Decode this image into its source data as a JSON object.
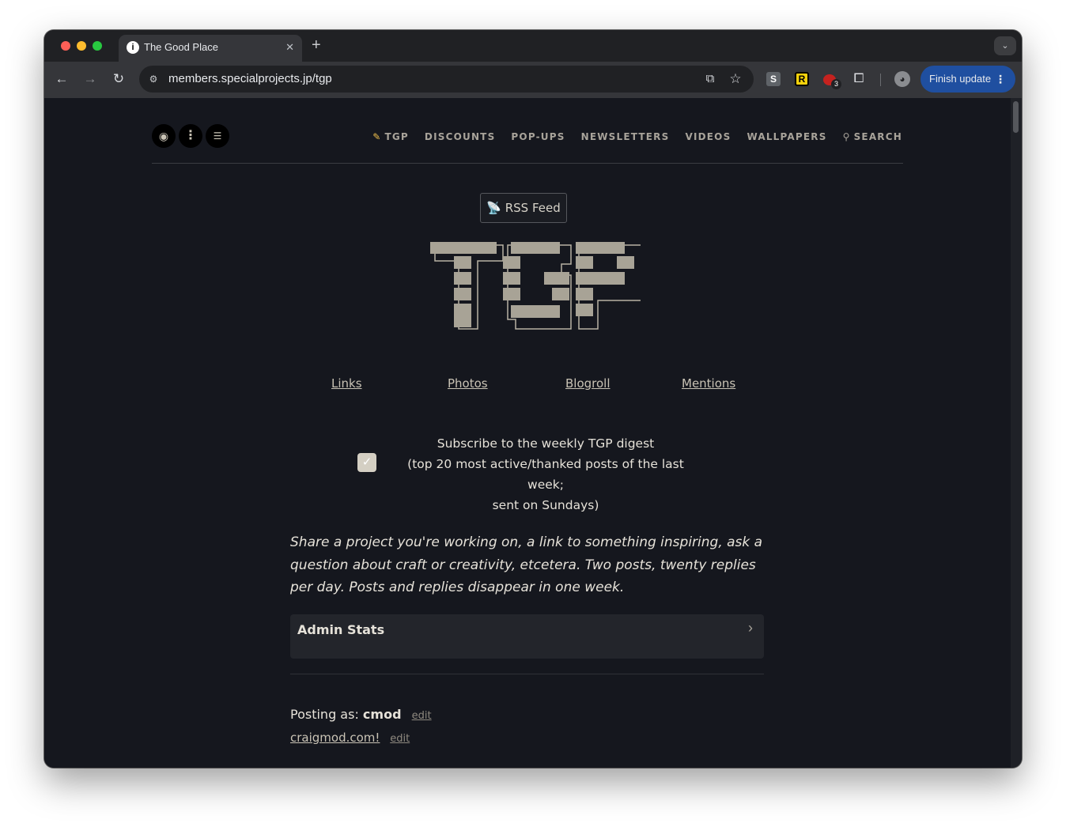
{
  "browser": {
    "tab_title": "The Good Place",
    "tab_favicon": "i",
    "url": "members.specialprojects.jp/tgp",
    "finish_update_label": "Finish update",
    "extensions": {
      "s_label": "S",
      "r_label": "R",
      "badge_count": "3"
    }
  },
  "page": {
    "nav": {
      "items": [
        "TGP",
        "DISCOUNTS",
        "POP-UPS",
        "NEWSLETTERS",
        "VIDEOS",
        "WALLPAPERS",
        "SEARCH"
      ],
      "icons": [
        "pencil-icon",
        "magnifier-icon"
      ]
    },
    "rss_label": "RSS Feed",
    "logo_text": "TGP",
    "links": [
      "Links",
      "Photos",
      "Blogroll",
      "Mentions"
    ],
    "subscribe": {
      "checked": true,
      "line1": "Subscribe to the weekly TGP digest",
      "line2": "(top 20 most active/thanked posts of the last week;",
      "line3": "sent on Sundays)"
    },
    "description": "Share a project you're working on, a link to something inspiring, ask a question about craft or creativity, etcetera. Two posts, twenty replies per day. Posts and replies disappear in one week.",
    "admin_stats_label": "Admin Stats",
    "posting": {
      "prefix": "Posting as: ",
      "username": "cmod",
      "edit_label": "edit",
      "homepage": "craigmod.com!",
      "homepage_edit_label": "edit"
    }
  },
  "colors": {
    "page_bg": "#15171e",
    "text": "#e6e2d9",
    "muted": "#a8a39a",
    "accent_blue": "#1f4fa0"
  }
}
